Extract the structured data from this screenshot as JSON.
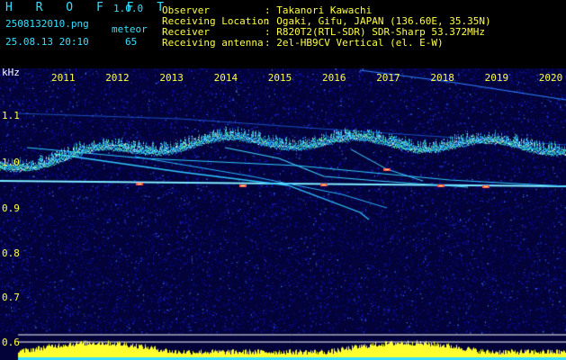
{
  "app": {
    "title": "H R O F F T",
    "version": "1.0.0",
    "filename": "2508132010.png",
    "datetime": "25.08.13 20:10",
    "meteor_label": "meteor",
    "meteor_count": "65"
  },
  "info": {
    "observer_label": "Observer",
    "observer_value": ": Takanori Kawachi",
    "location_label": "Receiving Location",
    "location_value": ": Ogaki, Gifu, JAPAN (136.60E, 35.35N)",
    "receiver_label": "Receiver",
    "receiver_value": ": R820T2(RTL-SDR) SDR-Sharp 53.372MHz",
    "antenna_label": "Receiving antenna",
    "antenna_value": ": 2el-HB9CV Vertical (el. E-W)"
  },
  "chart_data": {
    "type": "heatmap",
    "ylabel": "kHz",
    "x_ticks": [
      "2011",
      "2012",
      "2013",
      "2014",
      "2015",
      "2016",
      "2017",
      "2018",
      "2019",
      "2020"
    ],
    "y_ticks": [
      "1.1",
      "1.0",
      "0.9",
      "0.8",
      "0.7",
      "0.6"
    ],
    "ylim": [
      0.6,
      1.15
    ],
    "xlabel": ""
  },
  "colors": {
    "cyan": "#35e0ff",
    "yellow": "#ffff40",
    "background": "#000000",
    "noise": "#0a0a8a"
  }
}
